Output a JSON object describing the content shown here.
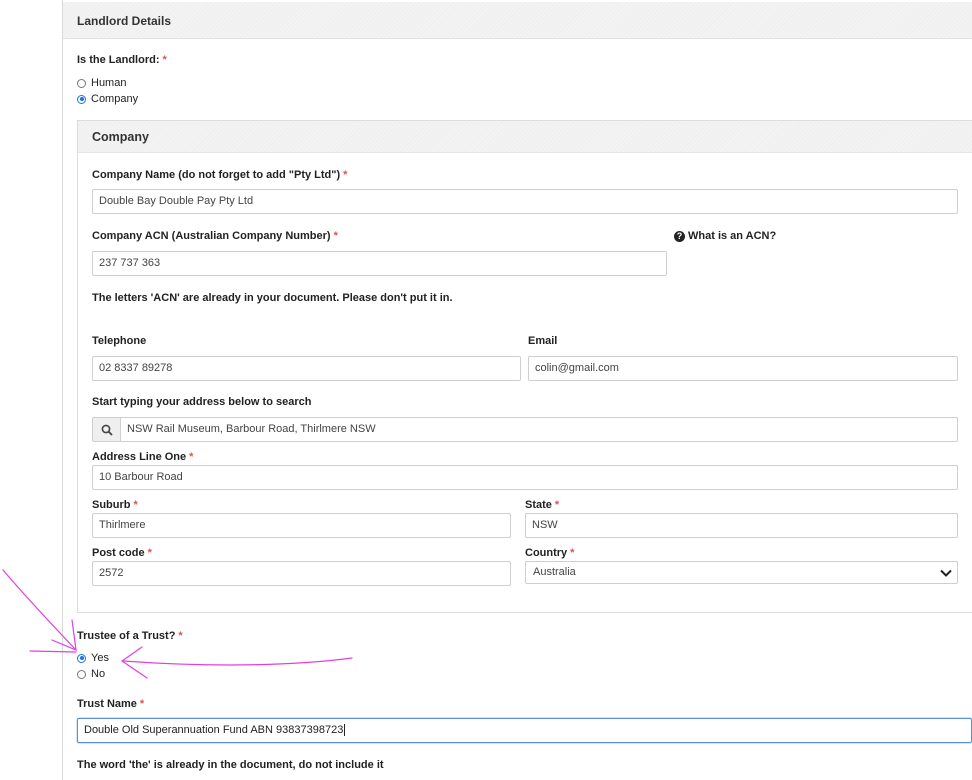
{
  "panel": {
    "title": "Landlord Details"
  },
  "landlord_type": {
    "label": "Is the Landlord:",
    "required": "*",
    "options": [
      {
        "label": "Human",
        "checked": false
      },
      {
        "label": "Company",
        "checked": true
      }
    ]
  },
  "company": {
    "title": "Company",
    "name": {
      "label": "Company Name (do not forget to add \"Pty Ltd\")",
      "required": "*",
      "value": "Double Bay Double Pay Pty Ltd"
    },
    "acn": {
      "label": "Company ACN (Australian Company Number)",
      "required": "*",
      "value": "237 737 363",
      "help": "What is an ACN?",
      "note": "The letters 'ACN' are already in your document. Please don't put it in."
    },
    "telephone": {
      "label": "Telephone",
      "value": "02 8337 89278"
    },
    "email": {
      "label": "Email",
      "value": "colin@gmail.com"
    },
    "address_search": {
      "label": "Start typing your address below to search",
      "value": "NSW Rail Museum, Barbour Road, Thirlmere NSW"
    },
    "address_line_one": {
      "label": "Address Line One",
      "required": "*",
      "value": "10 Barbour Road"
    },
    "suburb": {
      "label": "Suburb",
      "required": "*",
      "value": "Thirlmere"
    },
    "state": {
      "label": "State",
      "required": "*",
      "value": "NSW"
    },
    "postcode": {
      "label": "Post code",
      "required": "*",
      "value": "2572"
    },
    "country": {
      "label": "Country",
      "required": "*",
      "value": "Australia"
    }
  },
  "trustee": {
    "label": "Trustee of a Trust?",
    "required": "*",
    "options": [
      {
        "label": "Yes",
        "checked": true
      },
      {
        "label": "No",
        "checked": false
      }
    ]
  },
  "trust_name": {
    "label": "Trust Name",
    "required": "*",
    "value": "Double Old Superannuation Fund ABN 93837398723",
    "note": "The word 'the' is already in the document, do not include it"
  },
  "colors": {
    "accent": "#1a73e8",
    "required": "#d9534f",
    "annotation": "#e040e0"
  },
  "icons": {
    "search": "search-icon",
    "help": "question-circle-icon",
    "select": "chevron-down-icon"
  }
}
